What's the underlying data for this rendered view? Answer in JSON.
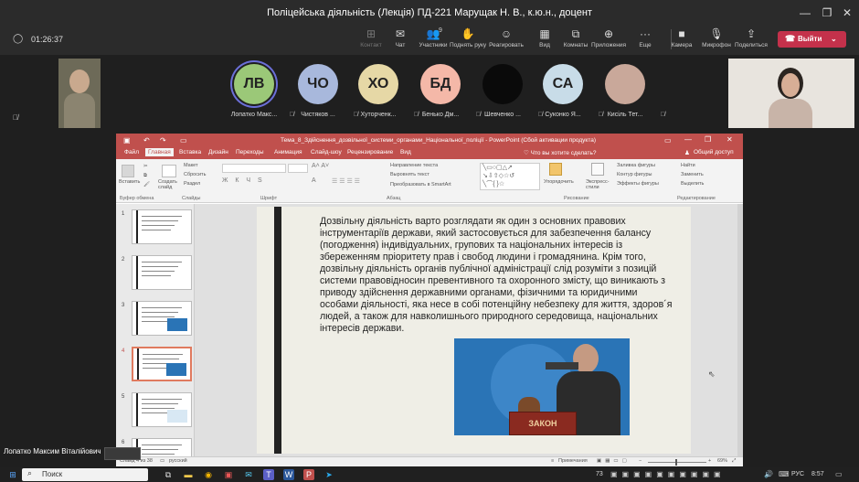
{
  "window": {
    "title": "Поліцейська діяльність (Лекція) ПД-221 Марущак Н. В., к.ю.н., доцент"
  },
  "meeting": {
    "timer": "01:26:37",
    "tools": [
      {
        "label": "Контакт",
        "icon": "grid-icon"
      },
      {
        "label": "Чат",
        "icon": "chat-icon"
      },
      {
        "label": "Участники",
        "icon": "people-icon",
        "badge": "9"
      },
      {
        "label": "Поднять руку",
        "icon": "hand-icon"
      },
      {
        "label": "Реагировать",
        "icon": "smile-icon"
      },
      {
        "label": "Вид",
        "icon": "view-icon"
      },
      {
        "label": "Комнаты",
        "icon": "rooms-icon"
      },
      {
        "label": "Приложения",
        "icon": "apps-icon"
      },
      {
        "label": "Еще",
        "icon": "more-icon"
      },
      {
        "label": "Камера",
        "icon": "camera-icon"
      },
      {
        "label": "Микрофон",
        "icon": "mic-icon"
      },
      {
        "label": "Поделиться",
        "icon": "share-icon"
      }
    ],
    "leave_label": "Выйти"
  },
  "participants": [
    {
      "initials": "ЛВ",
      "name": "Лопатко Макс...",
      "color": "#9bc878"
    },
    {
      "initials": "ЧО",
      "name": "Чистяков ...",
      "color": "#a8b8dc"
    },
    {
      "initials": "ХО",
      "name": "Хуторченк...",
      "color": "#e6d8a6"
    },
    {
      "initials": "БД",
      "name": "Бенько Дм...",
      "color": "#f4b8a8"
    },
    {
      "initials": "",
      "name": "Шевченко ...",
      "color": "#0a0a0a"
    },
    {
      "initials": "СА",
      "name": "Суконко Я...",
      "color": "#c8dce8"
    },
    {
      "initials": "",
      "name": "Кисіль Тет...",
      "color": "#c9a89a"
    }
  ],
  "ppt": {
    "title": "Тема_8_Здійснення_дозвільної_системи_органами_Національної_поліції - PowerPoint (Сбой активации продукта)",
    "tabs": [
      "Файл",
      "Главная",
      "Вставка",
      "Дизайн",
      "Переходы",
      "Анимация",
      "Слайд-шоу",
      "Рецензирование",
      "Вид"
    ],
    "tell": "♡ Что вы хотите сделать?",
    "share": "Общий доступ",
    "ribbon": {
      "paste": "Вставить",
      "newslide": "Создать слайд",
      "layout": "Макет",
      "reset": "Сбросить",
      "section": "Раздел",
      "text_dir": "Направление текста",
      "align_text": "Выровнять текст",
      "smartart": "Преобразовать в SmartArt",
      "arrange": "Упорядочить",
      "quick": "Экспресс-стили",
      "fill": "Заливка фигуры",
      "outline": "Контур фигуры",
      "effects": "Эффекты фигуры",
      "find": "Найти",
      "replace": "Заменить",
      "select": "Выделить",
      "groups": [
        "Буфер обмена",
        "Слайды",
        "Шрифт",
        "Абзац",
        "Рисование",
        "Редактирование"
      ]
    },
    "thumb_numbers": [
      "1",
      "2",
      "3",
      "4",
      "5",
      "6"
    ],
    "slide_text": "Дозвільну діяльність варто розглядати як один з основних правових інструментаріїв держави, який застосовується для забезпечення балансу (погодження) індивідуальних, групових та національних інтересів із збереженням пріоритету прав і свобод людини і громадянина. Крім того, дозвільну діяльність органів публічної адміністрації слід розуміти з позицій системи правовідносин превентивного та охоронного змісту, що виникають з приводу здійснення державними органами, фізичними та юридичними особами діяльності, яка несе в собі потенційну небезпеку для життя, здоров´я людей, а також для навколишнього природного середовища, національних інтересів держави.",
    "image_book_text": "ЗАКОН",
    "status": {
      "slide": "Слайд 4 из 38",
      "lang": "русский",
      "notes": "Примечания",
      "zoom": "69%"
    }
  },
  "self_name": "Лопатко Максим Віталійович",
  "taskbar": {
    "search": "Поиск",
    "lang": "РУС",
    "time": "8:57",
    "badge": "73"
  }
}
